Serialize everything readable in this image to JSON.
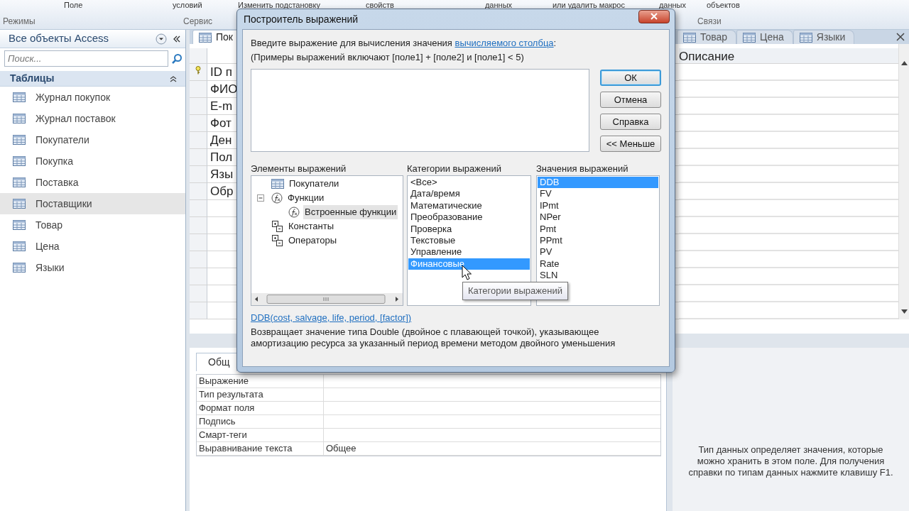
{
  "ribbon": {
    "buttons": [
      "Поле",
      "условий",
      "Изменить подстановку",
      "свойств",
      "данных",
      "или удалить макрос",
      "данных",
      "объектов"
    ],
    "groups": [
      "Режимы",
      "Сервис",
      "Связи"
    ]
  },
  "nav": {
    "title": "Все объекты Access",
    "search": {
      "placeholder": "Поиск..."
    },
    "section": {
      "label": "Таблицы",
      "expanded": true
    },
    "items": [
      {
        "label": "Журнал покупок",
        "selected": false
      },
      {
        "label": "Журнал поставок",
        "selected": false
      },
      {
        "label": "Покупатели",
        "selected": false
      },
      {
        "label": "Покупка",
        "selected": false
      },
      {
        "label": "Поставка",
        "selected": false
      },
      {
        "label": "Поставщики",
        "selected": true
      },
      {
        "label": "Товар",
        "selected": false
      },
      {
        "label": "Цена",
        "selected": false
      },
      {
        "label": "Языки",
        "selected": false
      }
    ]
  },
  "document_tabs": [
    {
      "label": "Пок",
      "selected": true
    },
    {
      "label": "Товар",
      "selected": false
    },
    {
      "label": "Цена",
      "selected": false
    },
    {
      "label": "Языки",
      "selected": false
    }
  ],
  "design_grid": {
    "description_header": "Описание",
    "fields": [
      {
        "name": "ID п",
        "primary_key": true
      },
      {
        "name": "ФИО",
        "primary_key": false
      },
      {
        "name": "E-m",
        "primary_key": false
      },
      {
        "name": "Фот",
        "primary_key": false
      },
      {
        "name": "Ден",
        "primary_key": false
      },
      {
        "name": "Пол",
        "primary_key": false
      },
      {
        "name": "Язы",
        "primary_key": false
      },
      {
        "name": "Обр",
        "primary_key": false
      }
    ]
  },
  "properties": {
    "tab": "Общ",
    "rows": [
      {
        "label": "Выражение"
      },
      {
        "label": "Тип результата"
      },
      {
        "label": "Формат поля"
      },
      {
        "label": "Подпись"
      },
      {
        "label": "Смарт-теги"
      },
      {
        "label": "Выравнивание текста",
        "value": "Общее"
      }
    ],
    "help": "Тип данных определяет значения, которые можно хранить в этом поле. Для получения справки по типам данных нажмите клавишу F1."
  },
  "dialog": {
    "title": "Построитель выражений",
    "prompt": {
      "before": "Введите выражение для вычисления значения ",
      "link": "вычисляемого столбца",
      "after": ":"
    },
    "examples": "(Примеры выражений включают [поле1] + [поле2] и [поле1] < 5)",
    "buttons": [
      {
        "label": "ОК",
        "default": true
      },
      {
        "label": "Отмена",
        "default": false
      },
      {
        "label": "Справка",
        "default": false
      },
      {
        "label": "<< Меньше",
        "default": false
      }
    ],
    "elements": {
      "label": "Элементы выражений",
      "tree": [
        {
          "label": "Покупатели",
          "kind": "table",
          "selected": false
        },
        {
          "label": "Функции",
          "kind": "function",
          "selected": false,
          "expanded": true,
          "children": [
            {
              "label": "Встроенные функции",
              "kind": "function",
              "selected": true
            }
          ]
        },
        {
          "label": "Константы",
          "kind": "group",
          "selected": false
        },
        {
          "label": "Операторы",
          "kind": "group",
          "selected": false
        }
      ]
    },
    "categories": {
      "label": "Категории выражений",
      "items": [
        {
          "label": "<Все>",
          "selected": false
        },
        {
          "label": "Дата/время",
          "selected": false
        },
        {
          "label": "Математические",
          "selected": false
        },
        {
          "label": "Преобразование",
          "selected": false
        },
        {
          "label": "Проверка",
          "selected": false
        },
        {
          "label": "Текстовые",
          "selected": false
        },
        {
          "label": "Управление",
          "selected": false
        },
        {
          "label": "Финансовые",
          "selected": true
        }
      ]
    },
    "values": {
      "label": "Значения выражений",
      "items": [
        {
          "label": "DDB",
          "selected": true
        },
        {
          "label": "FV",
          "selected": false
        },
        {
          "label": "IPmt",
          "selected": false
        },
        {
          "label": "NPer",
          "selected": false
        },
        {
          "label": "Pmt",
          "selected": false
        },
        {
          "label": "PPmt",
          "selected": false
        },
        {
          "label": "PV",
          "selected": false
        },
        {
          "label": "Rate",
          "selected": false
        },
        {
          "label": "SLN",
          "selected": false
        }
      ]
    },
    "syntax": "DDB(cost, salvage, life, period, [factor])",
    "description": "Возвращает значение типа Double (двойное с плавающей точкой), указывающее амортизацию ресурса за указанный период времени методом двойного уменьшения",
    "tooltip": "Категории выражений"
  }
}
